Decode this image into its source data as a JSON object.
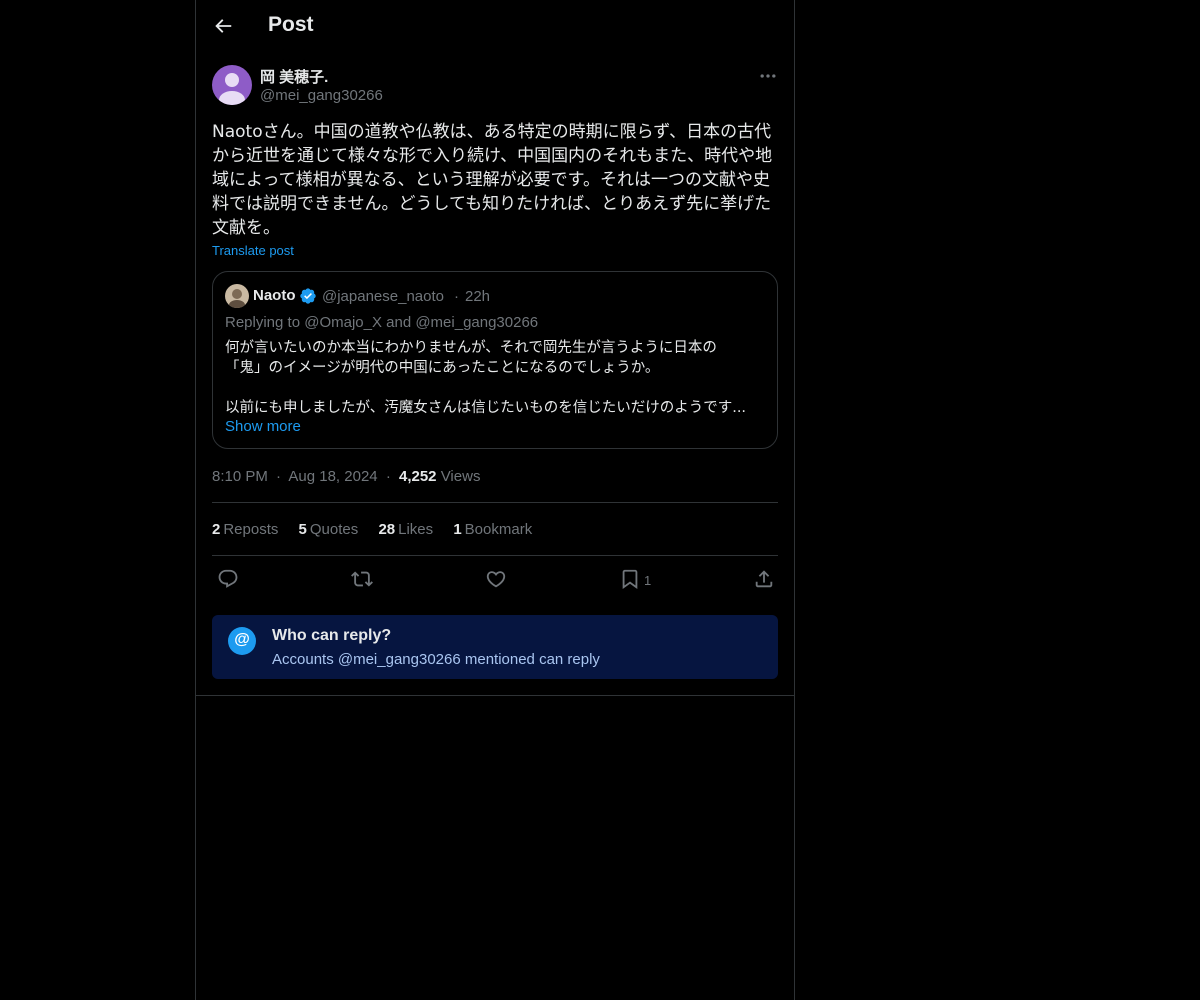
{
  "header": {
    "title": "Post"
  },
  "author": {
    "display_name": "岡 美穂子.",
    "handle": "@mei_gang30266"
  },
  "post": {
    "text": "Naotoさん。中国の道教や仏教は、ある特定の時期に限らず、日本の古代から近世を通じて様々な形で入り続け、中国国内のそれもまた、時代や地域によって様相が異なる、という理解が必要です。それは一つの文献や史料では説明できません。どうしても知りたければ、とりあえず先に挙げた文献を。",
    "translate_label": "Translate post"
  },
  "quote": {
    "name": "Naoto",
    "handle": "@japanese_naoto",
    "separator": "·",
    "time": "22h",
    "replying": "Replying to @Omajo_X and @mei_gang30266",
    "lines": [
      "何が言いたいのか本当にわかりませんが、それで岡先生が言うように日本の",
      "「鬼」のイメージが明代の中国にあったことになるのでしょうか。",
      "以前にも申しましたが、汚魔女さんは信じたいものを信じたいだけのようです..."
    ],
    "show_more": "Show more"
  },
  "meta": {
    "time": "8:10 PM",
    "date": "Aug 18, 2024",
    "sep": "·",
    "views_count": "4,252",
    "views_label": "Views"
  },
  "stats": [
    {
      "count": "2",
      "label": "Reposts"
    },
    {
      "count": "5",
      "label": "Quotes"
    },
    {
      "count": "28",
      "label": "Likes"
    },
    {
      "count": "1",
      "label": "Bookmark"
    }
  ],
  "actions": {
    "bookmark_count": "1"
  },
  "who_can_reply": {
    "icon_glyph": "@",
    "title": "Who can reply?",
    "subtitle": "Accounts @mei_gang30266 mentioned can reply"
  },
  "colors": {
    "background": "#000000",
    "text": "#e7e9ea",
    "muted": "#71767b",
    "accent": "#1d9bf0",
    "border": "#2f3336",
    "reply_banner": "#061540"
  }
}
